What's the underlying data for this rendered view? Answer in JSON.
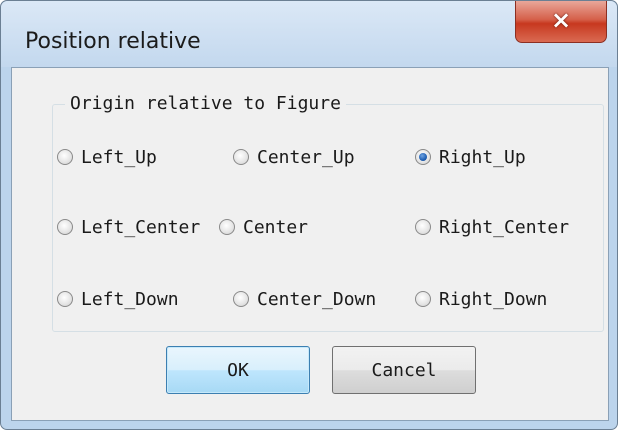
{
  "window": {
    "title": "Position relative",
    "close_icon": "×"
  },
  "group": {
    "label": "Origin relative to Figure",
    "options": [
      {
        "label": "Left_Up",
        "checked": false
      },
      {
        "label": "Center_Up",
        "checked": false
      },
      {
        "label": "Right_Up",
        "checked": true
      },
      {
        "label": "Left_Center",
        "checked": false
      },
      {
        "label": "Center",
        "checked": false
      },
      {
        "label": "Right_Center",
        "checked": false
      },
      {
        "label": "Left_Down",
        "checked": false
      },
      {
        "label": "Center_Down",
        "checked": false
      },
      {
        "label": "Right_Down",
        "checked": false
      }
    ]
  },
  "buttons": {
    "ok": "OK",
    "cancel": "Cancel"
  },
  "colors": {
    "close_button": "#c7381f",
    "default_button_border": "#3c7fb1",
    "radio_selected": "#1f5fb4"
  }
}
